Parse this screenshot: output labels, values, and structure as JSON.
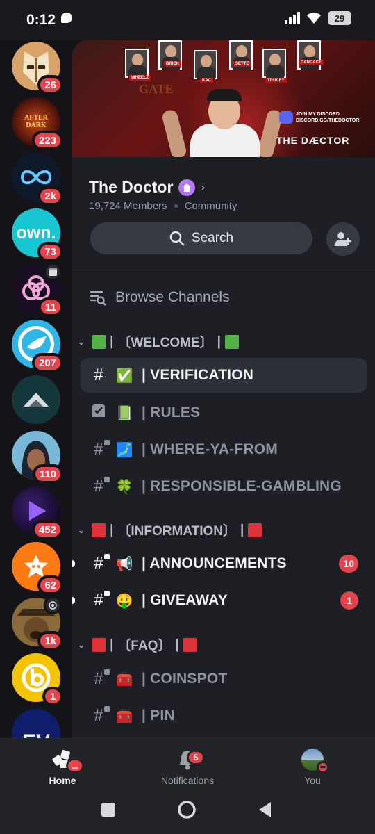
{
  "status": {
    "time": "0:12",
    "battery": "29"
  },
  "servers": [
    {
      "name": "knight-mask",
      "badge": "26"
    },
    {
      "name": "after-dark",
      "logo_text": "AFTER DARK",
      "badge": "223"
    },
    {
      "name": "infinity",
      "badge": "2k"
    },
    {
      "name": "own",
      "logo_text": "own.",
      "badge": "73"
    },
    {
      "name": "knot",
      "badge": "11",
      "corner": "calendar"
    },
    {
      "name": "bird",
      "badge": "207"
    },
    {
      "name": "mountain",
      "badge": ""
    },
    {
      "name": "hooded-avatar",
      "badge": "110"
    },
    {
      "name": "purple-play",
      "badge": "452"
    },
    {
      "name": "star-face",
      "badge": "62"
    },
    {
      "name": "dog-avatar",
      "badge": "1k",
      "corner": "broadcast"
    },
    {
      "name": "b-coin",
      "badge": "1"
    },
    {
      "name": "ev",
      "logo_text": "EV",
      "badge": ""
    }
  ],
  "banner": {
    "thumb_labels": [
      "WHEELZ",
      "BRICK",
      "KAC",
      "SETTE",
      "TRUCEY",
      "CANDACE"
    ],
    "discord_text_1": "JOIN MY DISCORD",
    "discord_text_2": "DISCORD.GG/THEDOCTOR!",
    "logo": "THE DÆCTOR",
    "background_text": "GATE"
  },
  "server": {
    "name": "The Doctor",
    "members": "19,724 Members",
    "type": "Community"
  },
  "search": {
    "label": "Search"
  },
  "browse": {
    "label": "Browse Channels"
  },
  "categories": [
    {
      "label": "〔WELCOME〕",
      "color": "green"
    },
    {
      "label": "〔INFORMATION〕",
      "color": "red"
    },
    {
      "label": "〔FAQ〕",
      "color": "red"
    }
  ],
  "channels": [
    {
      "emoji": "✅",
      "name": "| VERIFICATION",
      "state": "active"
    },
    {
      "emoji": "📗",
      "name": "| RULES",
      "state": "muted",
      "icon": "rules"
    },
    {
      "emoji": "🗾",
      "name": "| WHERE-YA-FROM",
      "state": "muted",
      "locked": true
    },
    {
      "emoji": "🍀",
      "name": "| RESPONSIBLE-GAMBLING",
      "state": "muted",
      "locked": true
    },
    {
      "emoji": "📢",
      "name": "| ANNOUNCEMENTS",
      "state": "unread",
      "locked": true,
      "badge": "10"
    },
    {
      "emoji": "🤑",
      "name": "| GIVEAWAY",
      "state": "unread",
      "locked": true,
      "badge": "1"
    },
    {
      "emoji": "🧰",
      "name": "| COINSPOT",
      "state": "muted",
      "locked": true
    },
    {
      "emoji": "🧰",
      "name": "| PIN",
      "state": "muted",
      "locked": true
    }
  ],
  "nav": {
    "home": "Home",
    "home_badge": "...",
    "notifications": "Notifications",
    "notifications_badge": "5",
    "you": "You"
  },
  "colors": {
    "accent_red": "#e5434d",
    "background": "#1e1f24",
    "rail": "#141418",
    "boost": "#b576f5"
  }
}
